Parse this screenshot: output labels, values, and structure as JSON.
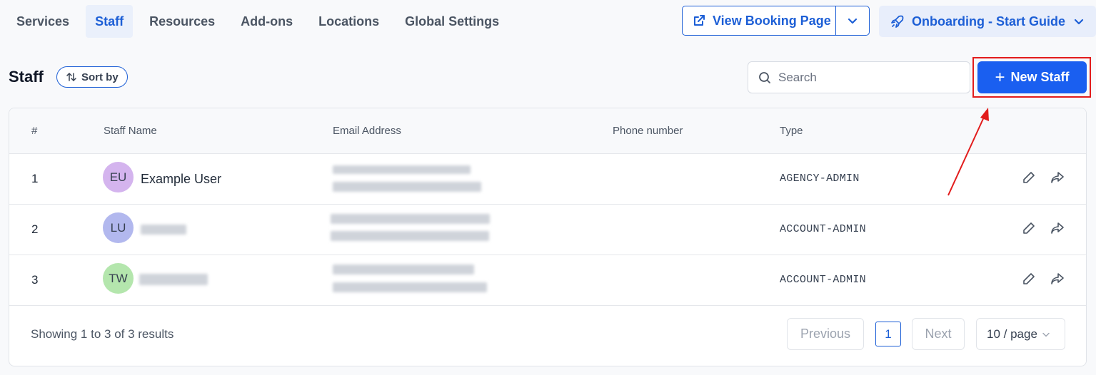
{
  "tabs": [
    {
      "label": "Services"
    },
    {
      "label": "Staff"
    },
    {
      "label": "Resources"
    },
    {
      "label": "Add-ons"
    },
    {
      "label": "Locations"
    },
    {
      "label": "Global Settings"
    }
  ],
  "active_tab": "Staff",
  "header": {
    "view_booking_label": "View Booking Page",
    "onboarding_label": "Onboarding - Start Guide"
  },
  "toolbar": {
    "title": "Staff",
    "sort_label": "Sort by",
    "search_placeholder": "Search",
    "new_staff_label": "New Staff"
  },
  "table": {
    "columns": [
      "#",
      "Staff Name",
      "Email Address",
      "Phone number",
      "Type"
    ],
    "rows": [
      {
        "index": "1",
        "initials": "EU",
        "name": "Example User",
        "type": "AGENCY-ADMIN",
        "avatar_color": "#d4b4ee"
      },
      {
        "index": "2",
        "initials": "LU",
        "name": "",
        "type": "ACCOUNT-ADMIN",
        "avatar_color": "#b2b8ee"
      },
      {
        "index": "3",
        "initials": "TW",
        "name": "",
        "type": "ACCOUNT-ADMIN",
        "avatar_color": "#b4e6ad"
      }
    ]
  },
  "footer": {
    "summary": "Showing 1 to 3 of 3 results",
    "previous_label": "Previous",
    "current_page": "1",
    "next_label": "Next",
    "per_page": "10 / page"
  },
  "colors": {
    "accent": "#1a5ff0",
    "highlight": "#e21c1c"
  },
  "icons": [
    "external-link-icon",
    "chevron-down-icon",
    "rocket-icon",
    "sort-icon",
    "search-icon",
    "plus-icon",
    "edit-pencil-icon",
    "share-arrow-icon"
  ]
}
